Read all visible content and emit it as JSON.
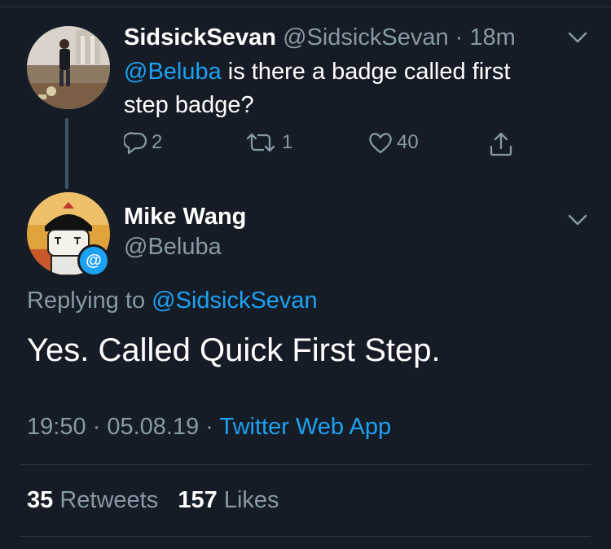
{
  "tweet1": {
    "display_name": "SidsickSevan",
    "handle": "@SidsickSevan",
    "time_sep": "·",
    "time": "18m",
    "mention": "@Beluba",
    "text": " is there a badge called first step badge?",
    "reply_count": "2",
    "retweet_count": "1",
    "like_count": "40",
    "icons": [
      "chevron-down-icon",
      "reply-icon",
      "retweet-icon",
      "heart-icon",
      "share-icon"
    ]
  },
  "tweet2": {
    "display_name": "Mike Wang",
    "handle": "@Beluba",
    "badge": "@",
    "replying_prefix": "Replying to ",
    "replying_to": "@SidsickSevan",
    "text": "Yes. Called Quick First Step.",
    "time": "19:50",
    "sep1": " · ",
    "date": "05.08.19",
    "sep2": " · ",
    "source": "Twitter Web App",
    "retweets_count": "35",
    "retweets_label": "Retweets",
    "likes_count": "157",
    "likes_label": "Likes"
  },
  "colors": {
    "background": "#151c26",
    "accent": "#1da1f2",
    "secondary_text": "#8899a6",
    "divider": "#2a3644"
  }
}
